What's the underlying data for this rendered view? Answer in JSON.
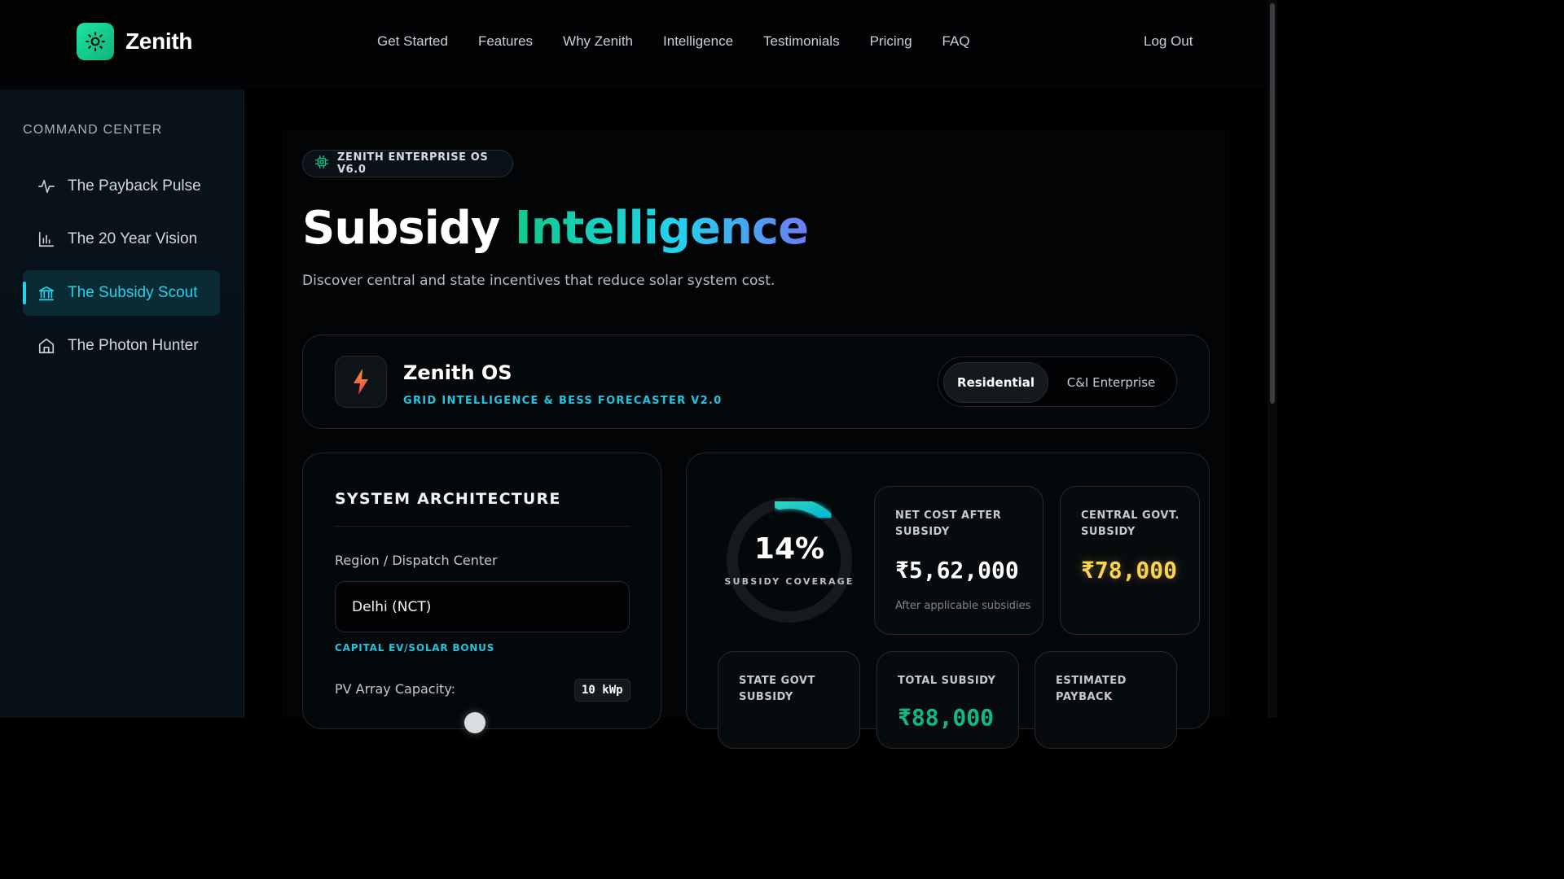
{
  "brand": {
    "name": "Zenith",
    "icon": "sun-icon",
    "accent": "#1ee3a3"
  },
  "nav": {
    "links": [
      "Get Started",
      "Features",
      "Why Zenith",
      "Intelligence",
      "Testimonials",
      "Pricing",
      "FAQ"
    ],
    "logout": "Log Out"
  },
  "sidebar": {
    "title": "COMMAND CENTER",
    "items": [
      {
        "label": "The Payback Pulse",
        "icon": "activity-icon",
        "active": false
      },
      {
        "label": "The 20 Year Vision",
        "icon": "bar-chart-icon",
        "active": false
      },
      {
        "label": "The Subsidy Scout",
        "icon": "bank-icon",
        "active": true
      },
      {
        "label": "The Photon Hunter",
        "icon": "home-icon",
        "active": false
      }
    ]
  },
  "main": {
    "badge": "ZENITH ENTERPRISE OS V6.0",
    "title_main": "Subsidy",
    "title_accent": "Intelligence",
    "subtitle": "Discover central and state incentives that reduce solar system cost.",
    "os_card": {
      "name": "Zenith OS",
      "tagline": "GRID INTELLIGENCE & BESS FORECASTER V2.0",
      "segments": [
        "Residential",
        "C&I Enterprise"
      ],
      "active_segment": "Residential"
    },
    "architecture": {
      "title": "SYSTEM ARCHITECTURE",
      "region_label": "Region / Dispatch Center",
      "region_value": "Delhi (NCT)",
      "bonus_label": "CAPITAL EV/SOLAR BONUS",
      "capacity_label": "PV Array Capacity:",
      "capacity_value": "10 kWp"
    },
    "results": {
      "coverage_percent": "14%",
      "coverage_fraction": 0.14,
      "coverage_label": "SUBSIDY COVERAGE",
      "net_cost": {
        "label": "NET COST AFTER SUBSIDY",
        "value": "₹5,62,000",
        "note": "After applicable subsidies",
        "color": "#ffffff"
      },
      "central": {
        "label": "CENTRAL GOVT. SUBSIDY",
        "value": "₹78,000",
        "color": "#fcd34d"
      },
      "state": {
        "label": "STATE GOVT SUBSIDY"
      },
      "total": {
        "label": "TOTAL SUBSIDY",
        "value": "₹88,000",
        "color": "#10b981"
      },
      "payback": {
        "label": "ESTIMATED PAYBACK"
      }
    }
  }
}
